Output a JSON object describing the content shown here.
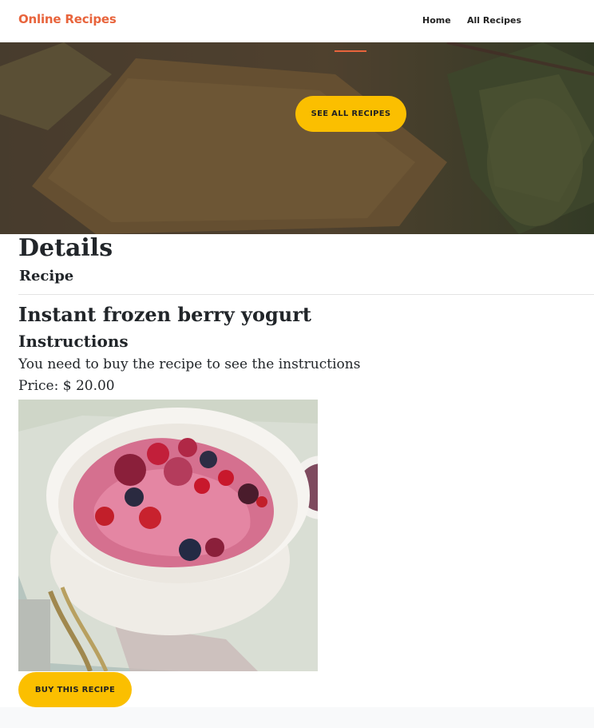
{
  "nav": {
    "brand": "Online Recipes",
    "links": [
      {
        "label": "Home"
      },
      {
        "label": "All Recipes"
      }
    ]
  },
  "hero": {
    "button_label": "SEE ALL RECIPES"
  },
  "details": {
    "heading": "Details",
    "subheading": "Recipe",
    "recipe_name": "Instant frozen berry yogurt",
    "instructions_heading": "Instructions",
    "instructions_text": "You need to buy the recipe to see the instructions",
    "price_label": "Price:",
    "price_currency": "$",
    "price_value": "20.00",
    "buy_button_label": "BUY THIS RECIPE"
  },
  "colors": {
    "brand": "#e8643c",
    "button": "#fbbf00",
    "text": "#212529"
  }
}
